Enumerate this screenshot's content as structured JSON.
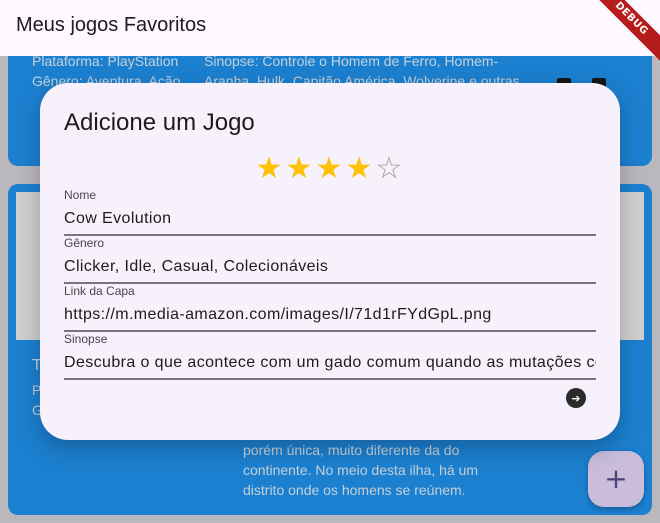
{
  "appbar": {
    "title": "Meus jogos Favoritos",
    "debug_label": "DEBUG"
  },
  "cards": [
    {
      "platform": "Plataforma: PlayStation",
      "genre": "Gênero: Aventura, Ação",
      "synopsis_line1": "Sinopse: Controle o Homem de Ferro, Homem-",
      "synopsis_line2": "Aranha, Hulk, Capitão América, Wolverine e outras"
    },
    {
      "title_initial": "T",
      "platform_initial": "P",
      "genre_initial": "G",
      "synopsis_line1": "porém única, muito diferente da do",
      "synopsis_line2": "continente. No meio desta ilha, há um",
      "synopsis_line3": "distrito onde os homens se reúnem."
    }
  ],
  "fab": {
    "icon": "plus-icon",
    "glyph": "+"
  },
  "dialog": {
    "title": "Adicione um Jogo",
    "rating": {
      "value": 4,
      "max": 5,
      "filled_glyph": "★",
      "empty_glyph": "☆"
    },
    "fields": [
      {
        "label": "Nome",
        "value": "Cow Evolution"
      },
      {
        "label": "Gênero",
        "value": "Clicker, Idle, Casual, Colecionáveis"
      },
      {
        "label": "Link da Capa",
        "value": "https://m.media-amazon.com/images/I/71d1rFYdGpL.png"
      },
      {
        "label": "Sinopse",
        "value": "Descubra o que acontece com um gado comum quando as mutações começam"
      }
    ],
    "submit_icon": "arrow-right-icon",
    "submit_glyph": "➜"
  },
  "colors": {
    "card": "#2196f3",
    "dialog": "#f6f1fa",
    "star_on": "#ffc107",
    "star_off": "#9e9e9e",
    "fab": "#eaddff"
  }
}
